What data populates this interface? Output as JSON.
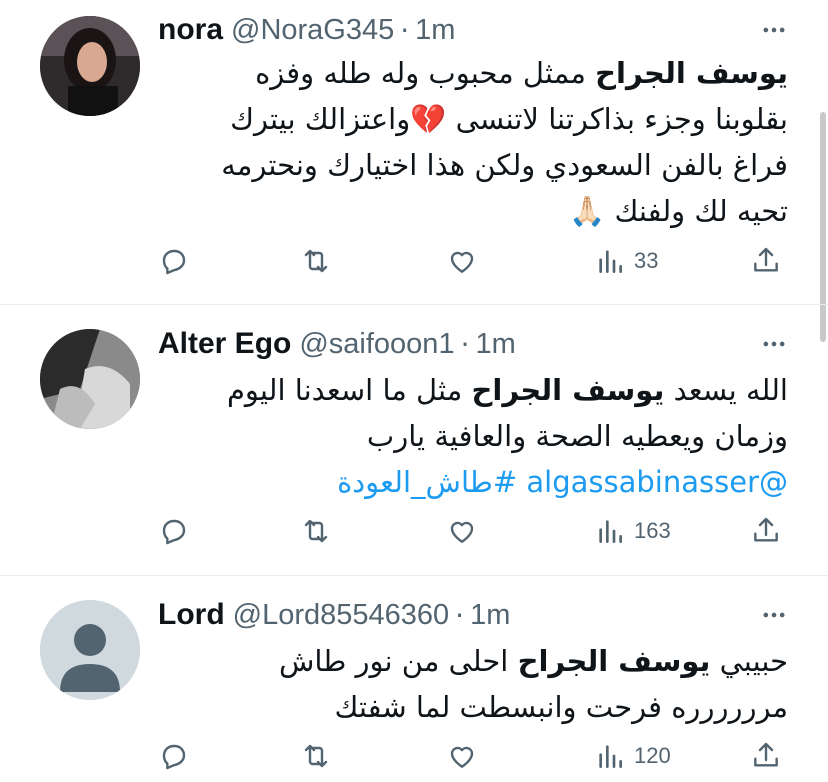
{
  "tweets": [
    {
      "name": "nora",
      "handle": "@NoraG345",
      "time": "1m",
      "body_lines": [
        {
          "bold": "يوسف الجراح",
          "text": " ممثل محبوب وله طله وفزه"
        },
        {
          "bold": "",
          "text": "بقلوبنا وجزء بذاكرتنا لاتنسى 💔واعتزالك بيترك"
        },
        {
          "bold": "",
          "text": "فراغ  بالفن السعودي ولكن هذا اختيارك ونحترمه"
        },
        {
          "bold": "",
          "text": "تحيه لك ولفنك 🙏🏻"
        }
      ],
      "views": "33"
    },
    {
      "name": "Alter Ego",
      "handle": "@saifooon1",
      "time": "1m",
      "body_lines": [
        {
          "pre": "الله يسعد ",
          "bold": "يوسف الجراح",
          "text": " مثل ما اسعدنا اليوم"
        },
        {
          "bold": "",
          "text": "وزمان ويعطيه الصحة والعافية يارب"
        }
      ],
      "links": "@algassabinasser #طاش_العودة",
      "views": "163"
    },
    {
      "name": "Lord",
      "handle": "@Lord85546360",
      "time": "1m",
      "body_lines": [
        {
          "pre": "حبيبي  ",
          "bold": "يوسف الجراح",
          "text": "  احلى من نور طاش"
        },
        {
          "bold": "",
          "text": "مرررررره فرحت وانبسطت لما شفتك"
        }
      ],
      "views": "120"
    }
  ],
  "separator": "·",
  "colors": {
    "text": "#0f1419",
    "muted": "#536471",
    "link": "#1d9bf0",
    "divider": "#e6ecf0"
  },
  "icons": [
    "reply-icon",
    "retweet-icon",
    "like-icon",
    "views-icon",
    "share-icon",
    "more-icon"
  ]
}
